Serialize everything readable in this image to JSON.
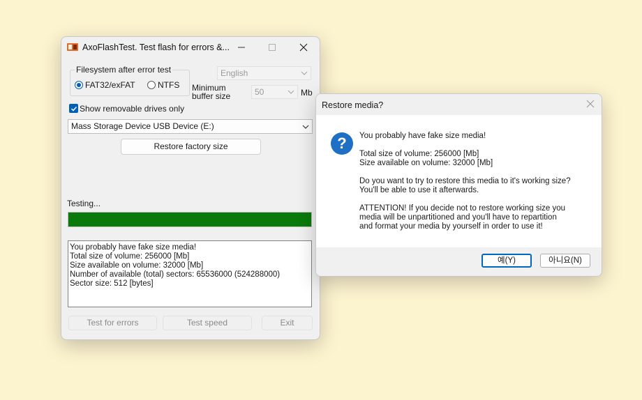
{
  "main_window": {
    "title": "AxoFlashTest. Test flash for errors &...",
    "filesystem_group": {
      "label": "Filesystem after error test",
      "options": [
        {
          "label": "FAT32/exFAT",
          "selected": true
        },
        {
          "label": "NTFS",
          "selected": false
        }
      ]
    },
    "language": {
      "value": "English"
    },
    "buffer": {
      "label_line1": "Minimum",
      "label_line2": "buffer size",
      "value": "50",
      "unit": "Mb"
    },
    "show_removable": {
      "label": "Show removable drives only",
      "checked": true
    },
    "device": {
      "value": "Mass Storage Device USB Device (E:)"
    },
    "restore_button": "Restore factory size",
    "status_label": "Testing...",
    "progress_percent": 100,
    "log_lines": [
      "You probably have fake size media!",
      "Total size of volume: 256000 [Mb]",
      "Size available on volume: 32000 [Mb]",
      "Number of available (total) sectors: 65536000 (524288000)",
      "Sector size: 512 [bytes]"
    ],
    "buttons": {
      "test_errors": "Test for errors",
      "test_speed": "Test speed",
      "exit": "Exit"
    }
  },
  "dialog": {
    "title": "Restore media?",
    "icon": "question-icon",
    "icon_glyph": "?",
    "line1": "You probably have fake size media!",
    "line2": "Total size of volume: 256000 [Mb]",
    "line3": "Size available on volume: 32000 [Mb]",
    "line4": "Do you want to try to restore this media to it's working size?",
    "line5": "You'll be able to use it afterwards.",
    "line6": "ATTENTION! If you decide not to restore working size you",
    "line7": "media will be unpartitioned and you'll have to repartition",
    "line8": "and format your media by yourself in order to use it!",
    "yes_button": "예(Y)",
    "no_button": "아니요(N)"
  },
  "colors": {
    "desktop": "#fcf3cf",
    "progress": "#0a7a0a",
    "accent": "#005fb8",
    "question_icon": "#1f6fc4"
  }
}
